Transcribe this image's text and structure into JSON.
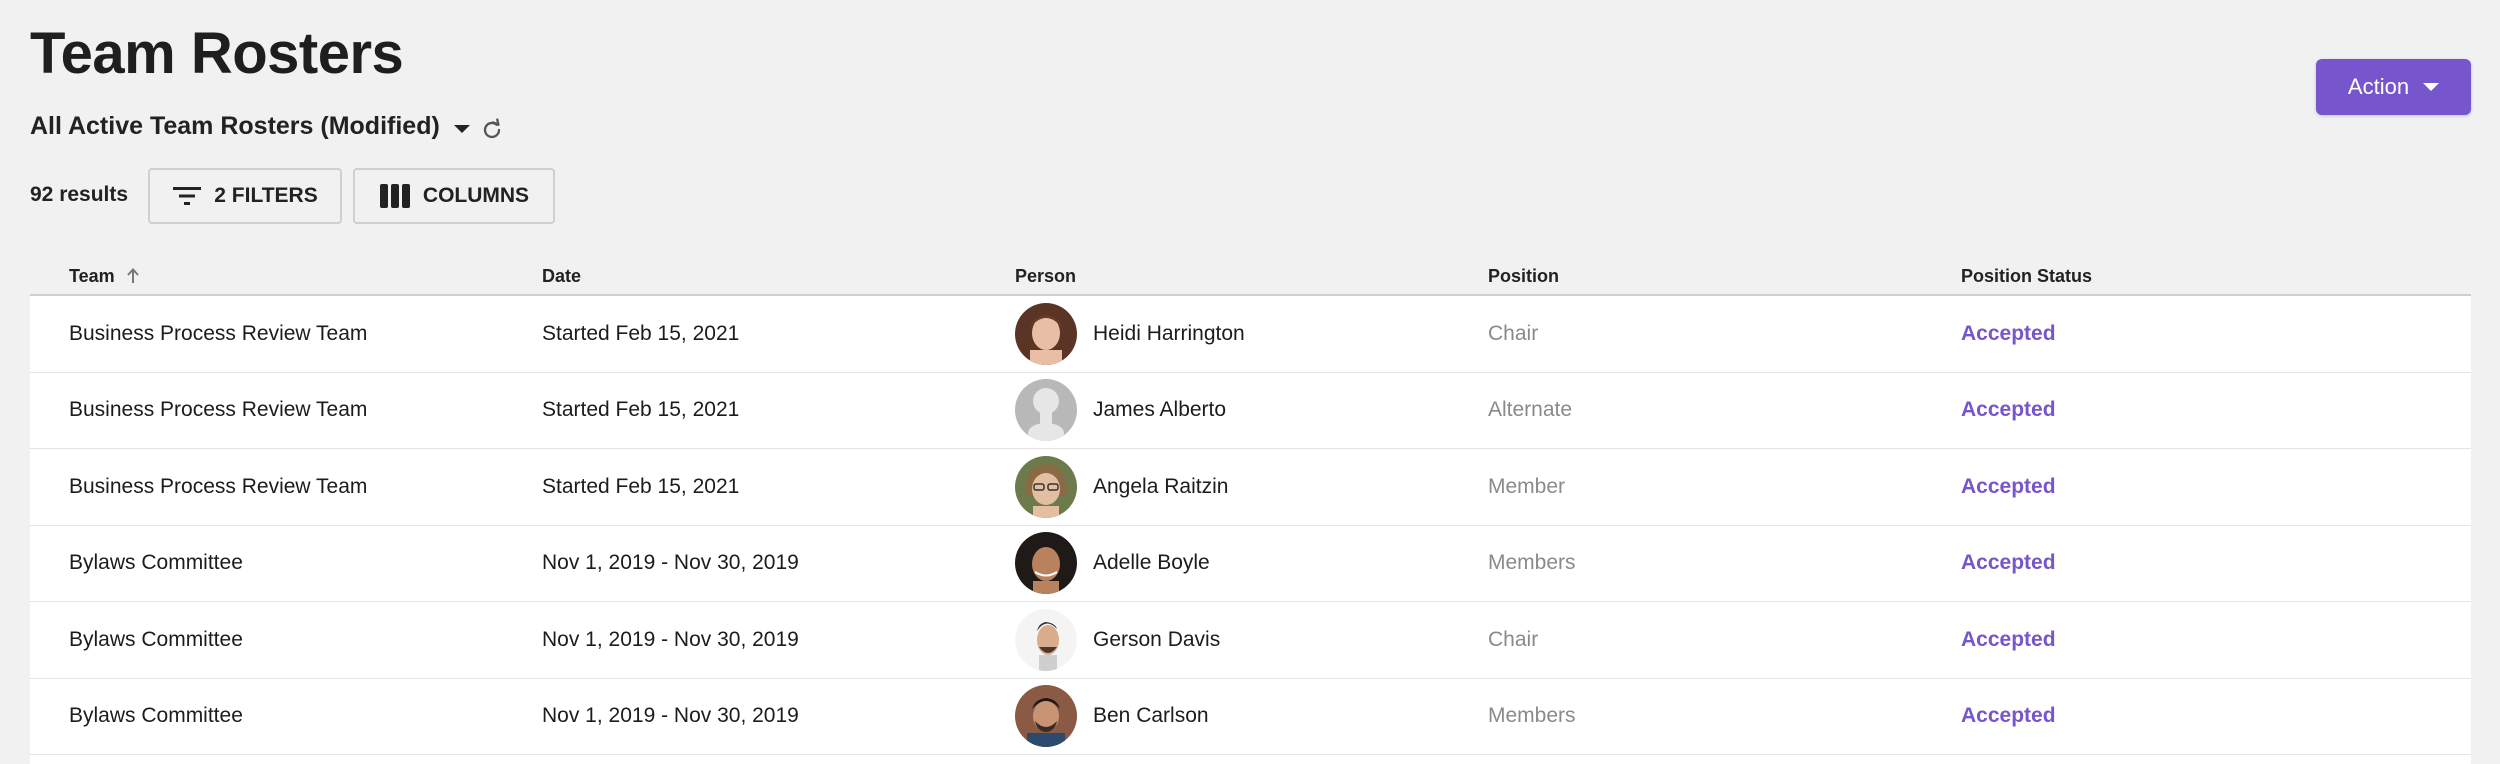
{
  "page": {
    "title": "Team Rosters"
  },
  "action_button": {
    "label": "Action"
  },
  "view": {
    "selected": "All Active Team Rosters (Modified)"
  },
  "toolbar": {
    "results": "92 results",
    "filters_label": "2 FILTERS",
    "columns_label": "COLUMNS"
  },
  "table": {
    "headers": {
      "team": "Team",
      "date": "Date",
      "person": "Person",
      "position": "Position",
      "status": "Position Status"
    },
    "rows": [
      {
        "team": "Business Process Review Team",
        "date": "Started Feb 15, 2021",
        "person": "Heidi Harrington",
        "position": "Chair",
        "status": "Accepted"
      },
      {
        "team": "Business Process Review Team",
        "date": "Started Feb 15, 2021",
        "person": "James Alberto",
        "position": "Alternate",
        "status": "Accepted"
      },
      {
        "team": "Business Process Review Team",
        "date": "Started Feb 15, 2021",
        "person": "Angela Raitzin",
        "position": "Member",
        "status": "Accepted"
      },
      {
        "team": "Bylaws Committee",
        "date": "Nov 1, 2019 - Nov 30, 2019",
        "person": "Adelle Boyle",
        "position": "Members",
        "status": "Accepted"
      },
      {
        "team": "Bylaws Committee",
        "date": "Nov 1, 2019 - Nov 30, 2019",
        "person": "Gerson Davis",
        "position": "Chair",
        "status": "Accepted"
      },
      {
        "team": "Bylaws Committee",
        "date": "Nov 1, 2019 - Nov 30, 2019",
        "person": "Ben Carlson",
        "position": "Members",
        "status": "Accepted"
      }
    ]
  },
  "colors": {
    "accent": "#7755cc",
    "background": "#f1f1f1",
    "muted_text": "#8a8a8a"
  },
  "icons": {
    "view_dropdown": "caret-down-icon",
    "refresh": "refresh-icon",
    "filters": "filter-icon",
    "columns": "columns-icon",
    "sort": "sort-up-icon"
  }
}
